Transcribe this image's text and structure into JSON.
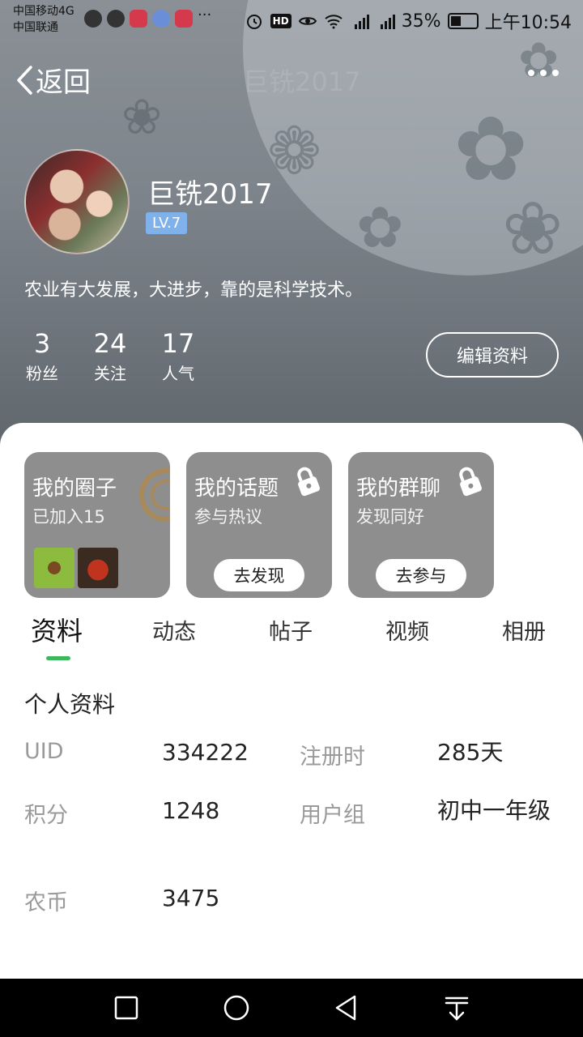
{
  "status_bar": {
    "carrier1": "中国移动4G",
    "carrier2": "中国联通",
    "battery": "35%",
    "time": "上午10:54"
  },
  "nav": {
    "back_label": "返回",
    "faint_title": "巨铣2017"
  },
  "profile": {
    "username": "巨铣2017",
    "level": "LV.7",
    "bio": "农业有大发展，大进步，靠的是科学技术。",
    "stats": [
      {
        "value": "3",
        "label": "粉丝"
      },
      {
        "value": "24",
        "label": "关注"
      },
      {
        "value": "17",
        "label": "人气"
      }
    ],
    "edit_button": "编辑资料"
  },
  "cards": [
    {
      "title": "我的圈子",
      "subtitle": "已加入15"
    },
    {
      "title": "我的话题",
      "subtitle": "参与热议",
      "button": "去发现"
    },
    {
      "title": "我的群聊",
      "subtitle": "发现同好",
      "button": "去参与"
    }
  ],
  "tabs": [
    "资料",
    "动态",
    "帖子",
    "视频",
    "相册"
  ],
  "active_tab": "资料",
  "info": {
    "title": "个人资料",
    "uid_label": "UID",
    "uid_value": "334222",
    "reg_label": "注册时",
    "reg_value": "285天",
    "points_label": "积分",
    "points_value": "1248",
    "group_label": "用户组",
    "group_value": "初中一年级",
    "coin_label": "农币",
    "coin_value": "3475"
  },
  "colors": {
    "accent_green": "#3cb85c",
    "level_badge": "#7fb2ea",
    "card_bg": "#8e8e8e"
  }
}
